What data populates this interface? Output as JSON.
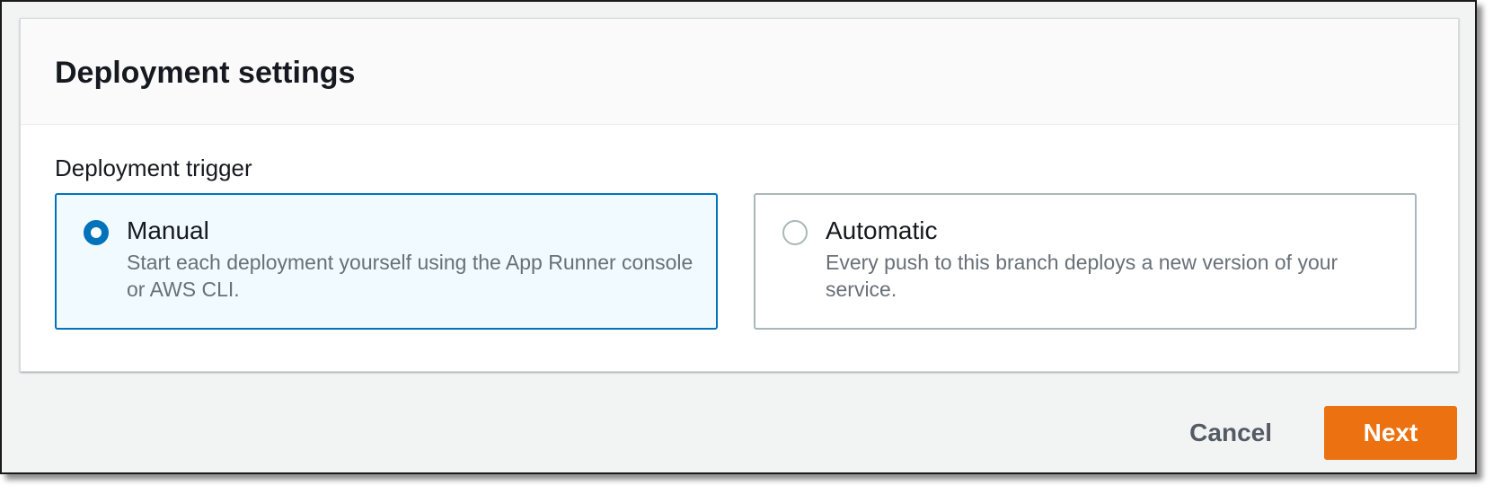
{
  "panel": {
    "title": "Deployment settings"
  },
  "deployment_trigger": {
    "label": "Deployment trigger",
    "selected": "Manual",
    "options": [
      {
        "title": "Manual",
        "description": "Start each deployment yourself using the App Runner console or AWS CLI.",
        "selected": true
      },
      {
        "title": "Automatic",
        "description": "Every push to this branch deploys a new version of your service.",
        "selected": false
      }
    ]
  },
  "actions": {
    "cancel_label": "Cancel",
    "next_label": "Next"
  },
  "colors": {
    "accent": "#0073bb",
    "primary_button": "#ec7211",
    "selected_tile_bg": "#f1faff"
  }
}
